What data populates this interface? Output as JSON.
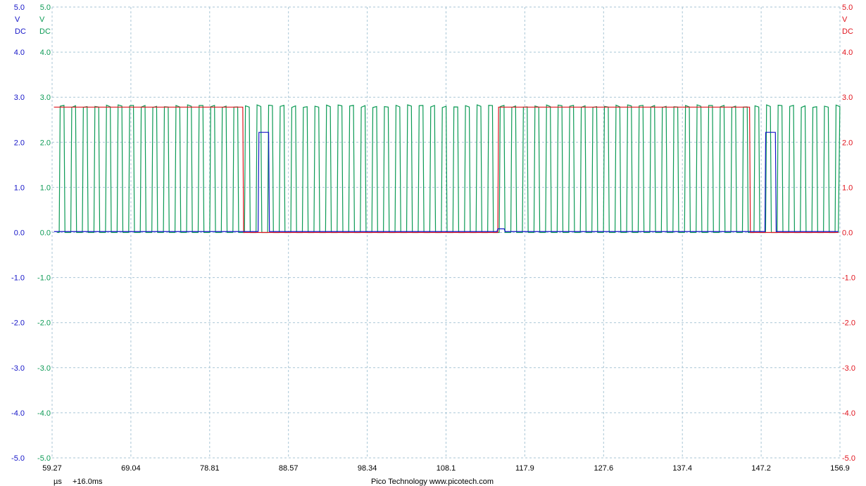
{
  "chart_data": {
    "type": "line",
    "title": "",
    "x_unit": "µs",
    "x_offset_label": "+16.0ms",
    "xlim": [
      59.27,
      156.9
    ],
    "x_tick_labels": [
      "59.27",
      "69.04",
      "78.81",
      "88.57",
      "98.34",
      "108.1",
      "117.9",
      "127.6",
      "137.4",
      "147.2",
      "156.9"
    ],
    "ylim": [
      -5.0,
      5.0
    ],
    "y_tick_values": [
      5.0,
      4.0,
      3.0,
      2.0,
      1.0,
      0.0,
      -1.0,
      -2.0,
      -3.0,
      -4.0,
      -5.0
    ],
    "y_tick_labels": [
      "5.0",
      "4.0",
      "3.0",
      "2.0",
      "1.0",
      "0.0",
      "-1.0",
      "-2.0",
      "-3.0",
      "-4.0",
      "-5.0"
    ],
    "grid": true,
    "axes": {
      "blue": {
        "color": "#1515c8",
        "unit": "V",
        "coupling": "DC",
        "side": "left"
      },
      "green": {
        "color": "#0c9a55",
        "unit": "V",
        "coupling": "DC",
        "side": "left"
      },
      "red": {
        "color": "#e0141e",
        "unit": "V",
        "coupling": "DC",
        "side": "right"
      }
    },
    "series": [
      {
        "color": "#0c9a55",
        "style": "square clock",
        "x_start": 59.9,
        "x_end": 156.7,
        "period": 1.185,
        "high": 2.8,
        "low": 0.0
      },
      {
        "color": "#e0141e",
        "style": "step",
        "points": [
          [
            59.5,
            2.78
          ],
          [
            82.9,
            2.78
          ],
          [
            83.0,
            0.0
          ],
          [
            114.5,
            0.0
          ],
          [
            114.6,
            2.78
          ],
          [
            145.7,
            2.78
          ],
          [
            145.8,
            0.0
          ],
          [
            156.7,
            0.0
          ]
        ]
      },
      {
        "color": "#1515c8",
        "style": "step",
        "points": [
          [
            59.5,
            0.02
          ],
          [
            84.8,
            0.02
          ],
          [
            84.9,
            2.22
          ],
          [
            86.1,
            2.22
          ],
          [
            86.2,
            0.02
          ],
          [
            114.4,
            0.02
          ],
          [
            114.5,
            0.08
          ],
          [
            115.3,
            0.08
          ],
          [
            115.4,
            0.02
          ],
          [
            147.6,
            0.02
          ],
          [
            147.7,
            2.22
          ],
          [
            148.9,
            2.22
          ],
          [
            149.0,
            0.02
          ],
          [
            156.7,
            0.02
          ]
        ]
      }
    ]
  },
  "footer": {
    "unit": "µs",
    "offset": "+16.0ms",
    "credit": "Pico Technology   www.picotech.com"
  }
}
